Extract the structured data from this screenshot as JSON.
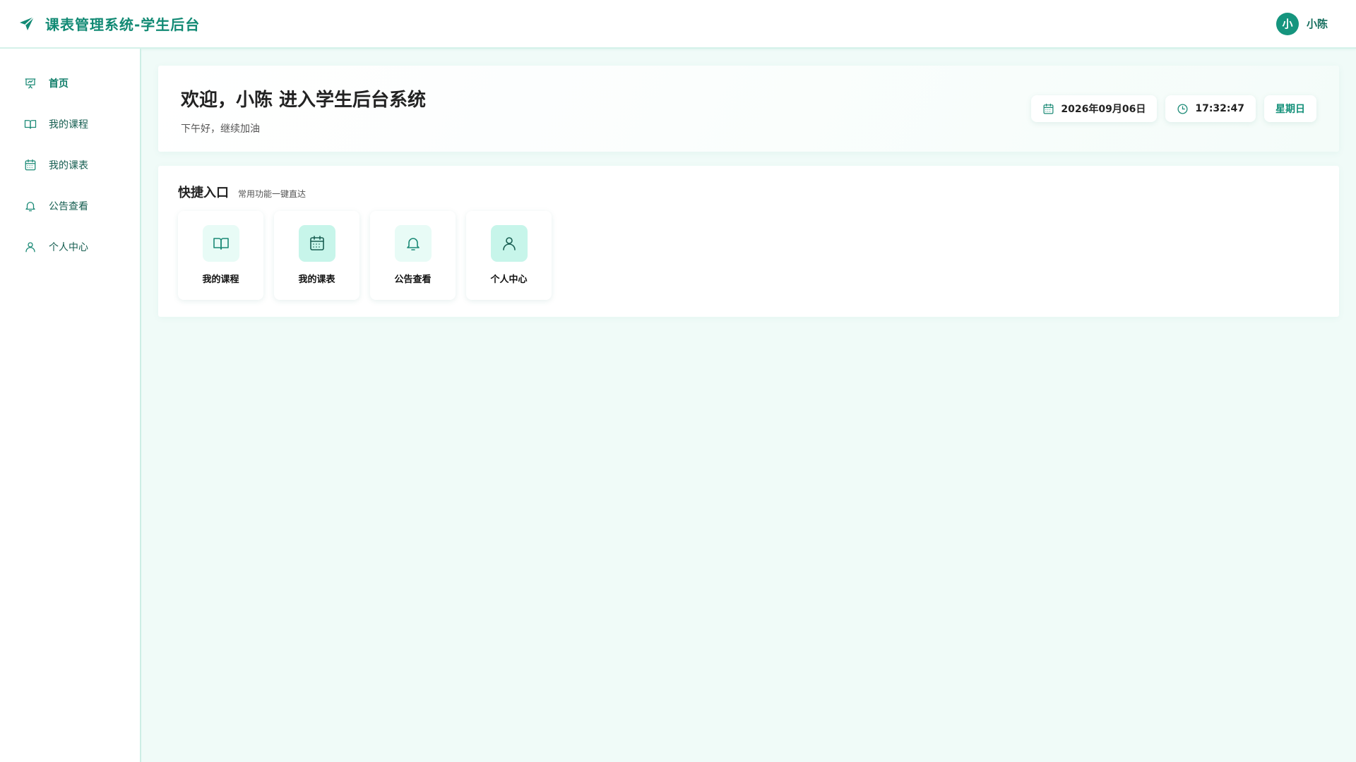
{
  "header": {
    "title": "课表管理系统-学生后台",
    "brand_icon": "paper-plane-icon",
    "user": {
      "avatar_text": "小",
      "name": "小陈"
    }
  },
  "sidebar": {
    "items": [
      {
        "label": "首页",
        "icon": "presentation-icon",
        "active": true
      },
      {
        "label": "我的课程",
        "icon": "book-icon",
        "active": false
      },
      {
        "label": "我的课表",
        "icon": "calendar-icon",
        "active": false
      },
      {
        "label": "公告查看",
        "icon": "bell-icon",
        "active": false
      },
      {
        "label": "个人中心",
        "icon": "user-icon",
        "active": false
      }
    ]
  },
  "welcome": {
    "title": "欢迎，小陈 进入学生后台系统",
    "subtitle": "下午好，继续加油",
    "date": "2026年09月06日",
    "time": "17:32:47",
    "weekday": "星期日"
  },
  "quick": {
    "title": "快捷入口",
    "subtitle": "常用功能一键直达",
    "cards": [
      {
        "label": "我的课程",
        "icon": "book-icon"
      },
      {
        "label": "我的课表",
        "icon": "calendar-icon"
      },
      {
        "label": "公告查看",
        "icon": "bell-icon"
      },
      {
        "label": "个人中心",
        "icon": "user-icon"
      }
    ]
  },
  "colors": {
    "accent": "#128a74",
    "background": "#f0fbf8",
    "avatar": "#15957e"
  }
}
